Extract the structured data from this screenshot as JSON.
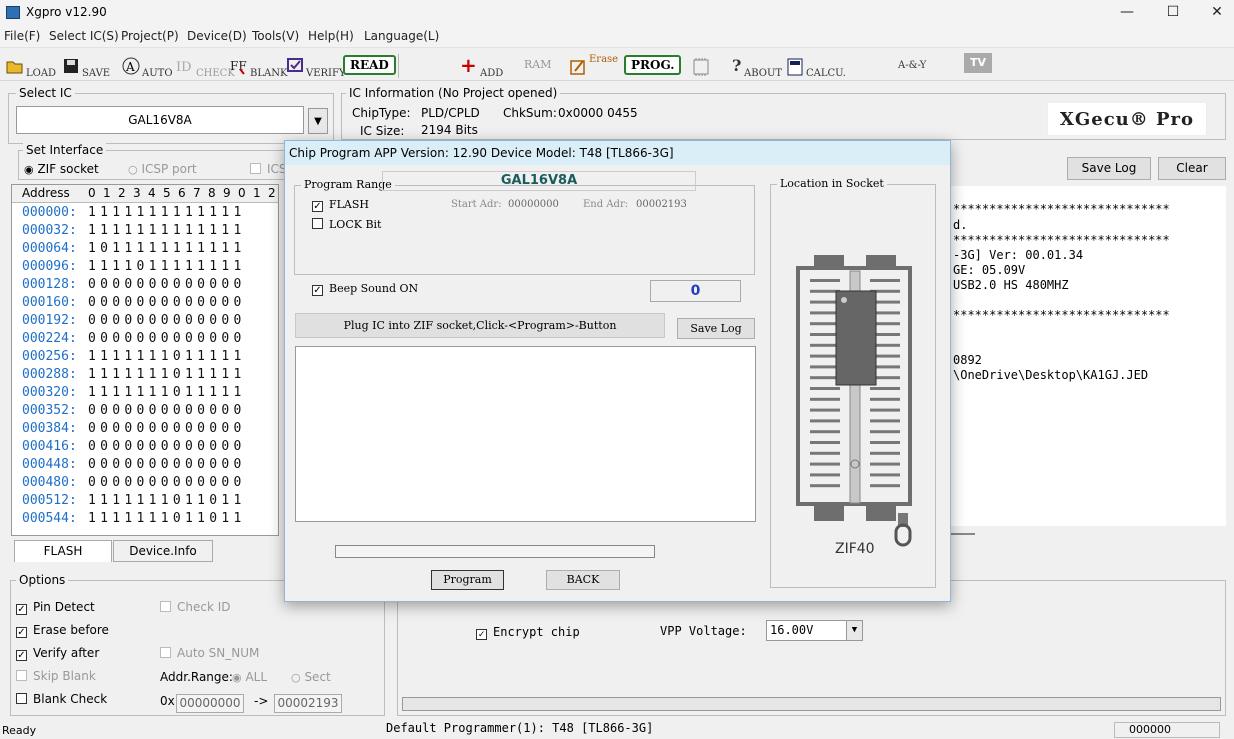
{
  "window": {
    "title": "Xgpro v12.90"
  },
  "menu": [
    "File(F)",
    "Select IC(S)",
    "Project(P)",
    "Device(D)",
    "Tools(V)",
    "Help(H)",
    "Language(L)"
  ],
  "toolbar": {
    "load": "LOAD",
    "save": "SAVE",
    "auto": "AUTO",
    "check": "CHECK",
    "blank": "BLANK",
    "verify": "VERIFY",
    "read": "READ",
    "add": "ADD",
    "ram": "RAM",
    "erase": "Erase",
    "prog": "PROG.",
    "about": "ABOUT",
    "calcu": "CALCU.",
    "logic": "A-&-Y",
    "tv": "TV"
  },
  "select_ic": {
    "label": "Select IC",
    "value": "GAL16V8A"
  },
  "ic_info": {
    "label": "IC Information (No Project opened)",
    "chiptype_label": "ChipType:",
    "chiptype": "PLD/CPLD",
    "chksum_label": "ChkSum:",
    "chksum": "0x0000 0455",
    "size_label": "IC Size:",
    "size": "2194 Bits"
  },
  "logo": "XGecu® Pro",
  "set_interface": {
    "label": "Set Interface",
    "zif": "ZIF socket",
    "icsp": "ICSP port",
    "ics": "ICS"
  },
  "grid": {
    "header_address": "Address",
    "header_cols": [
      "0",
      "1",
      "2",
      "3",
      "4",
      "5",
      "6",
      "7",
      "8",
      "9",
      "0",
      "1",
      "2"
    ],
    "rows": [
      {
        "addr": "000000:",
        "bits": "1111111111111"
      },
      {
        "addr": "000032:",
        "bits": "1111111111111"
      },
      {
        "addr": "000064:",
        "bits": "1011111111111"
      },
      {
        "addr": "000096:",
        "bits": "1111011111111"
      },
      {
        "addr": "000128:",
        "bits": "0000000000000"
      },
      {
        "addr": "000160:",
        "bits": "0000000000000"
      },
      {
        "addr": "000192:",
        "bits": "0000000000000"
      },
      {
        "addr": "000224:",
        "bits": "0000000000000"
      },
      {
        "addr": "000256:",
        "bits": "1111111011111"
      },
      {
        "addr": "000288:",
        "bits": "1111111011111"
      },
      {
        "addr": "000320:",
        "bits": "1111111011111"
      },
      {
        "addr": "000352:",
        "bits": "0000000000000"
      },
      {
        "addr": "000384:",
        "bits": "0000000000000"
      },
      {
        "addr": "000416:",
        "bits": "0000000000000"
      },
      {
        "addr": "000448:",
        "bits": "0000000000000"
      },
      {
        "addr": "000480:",
        "bits": "0000000000000"
      },
      {
        "addr": "000512:",
        "bits": "1111111011011"
      },
      {
        "addr": "000544:",
        "bits": "1111111011011"
      }
    ]
  },
  "tabs": {
    "flash": "FLASH",
    "device_info": "Device.Info"
  },
  "options": {
    "label": "Options",
    "pin_detect": "Pin Detect",
    "erase_before": "Erase before",
    "verify_after": "Verify after",
    "skip_blank": "Skip Blank",
    "blank_check": "Blank Check",
    "check_id": "Check ID",
    "auto_sn": "Auto SN_NUM",
    "addr_range": "Addr.Range:",
    "all": "ALL",
    "sect": "Sect",
    "prefix": "0x",
    "start": "00000000",
    "arrow": "->",
    "end": "00002193"
  },
  "log": {
    "save_log": "Save Log",
    "clear": "Clear",
    "lines": [
      "******************************",
      "d.",
      "******************************",
      "-3G] Ver: 00.01.34",
      "GE: 05.09V",
      " USB2.0 HS 480MHZ",
      "",
      "******************************",
      "",
      "",
      "0892",
      "\\OneDrive\\Desktop\\KA1GJ.JED"
    ]
  },
  "right_options": {
    "encrypt": "Encrypt chip",
    "vpp_label": "VPP Voltage:",
    "vpp_value": "16.00V"
  },
  "status": {
    "ready": "Ready",
    "programmer": "Default Programmer(1): T48 [TL866-3G]",
    "counter": "000000"
  },
  "dialog": {
    "title": "Chip Program    APP Version: 12.90 Device Model: T48 [TL866-3G]",
    "program_range": "Program Range",
    "chip": "GAL16V8A",
    "flash": "FLASH",
    "lock_bit": "LOCK Bit",
    "start_label": "Start Adr:",
    "start_value": "00000000",
    "end_label": "End Adr:",
    "end_value": "00002193",
    "beep": "Beep Sound ON",
    "count": "0",
    "message": "Plug IC into ZIF socket,Click-<Program>-Button",
    "save_log": "Save Log",
    "location": "Location in Socket",
    "socket_label": "ZIF40",
    "program_btn": "Program",
    "back_btn": "BACK",
    "progress": 0
  }
}
